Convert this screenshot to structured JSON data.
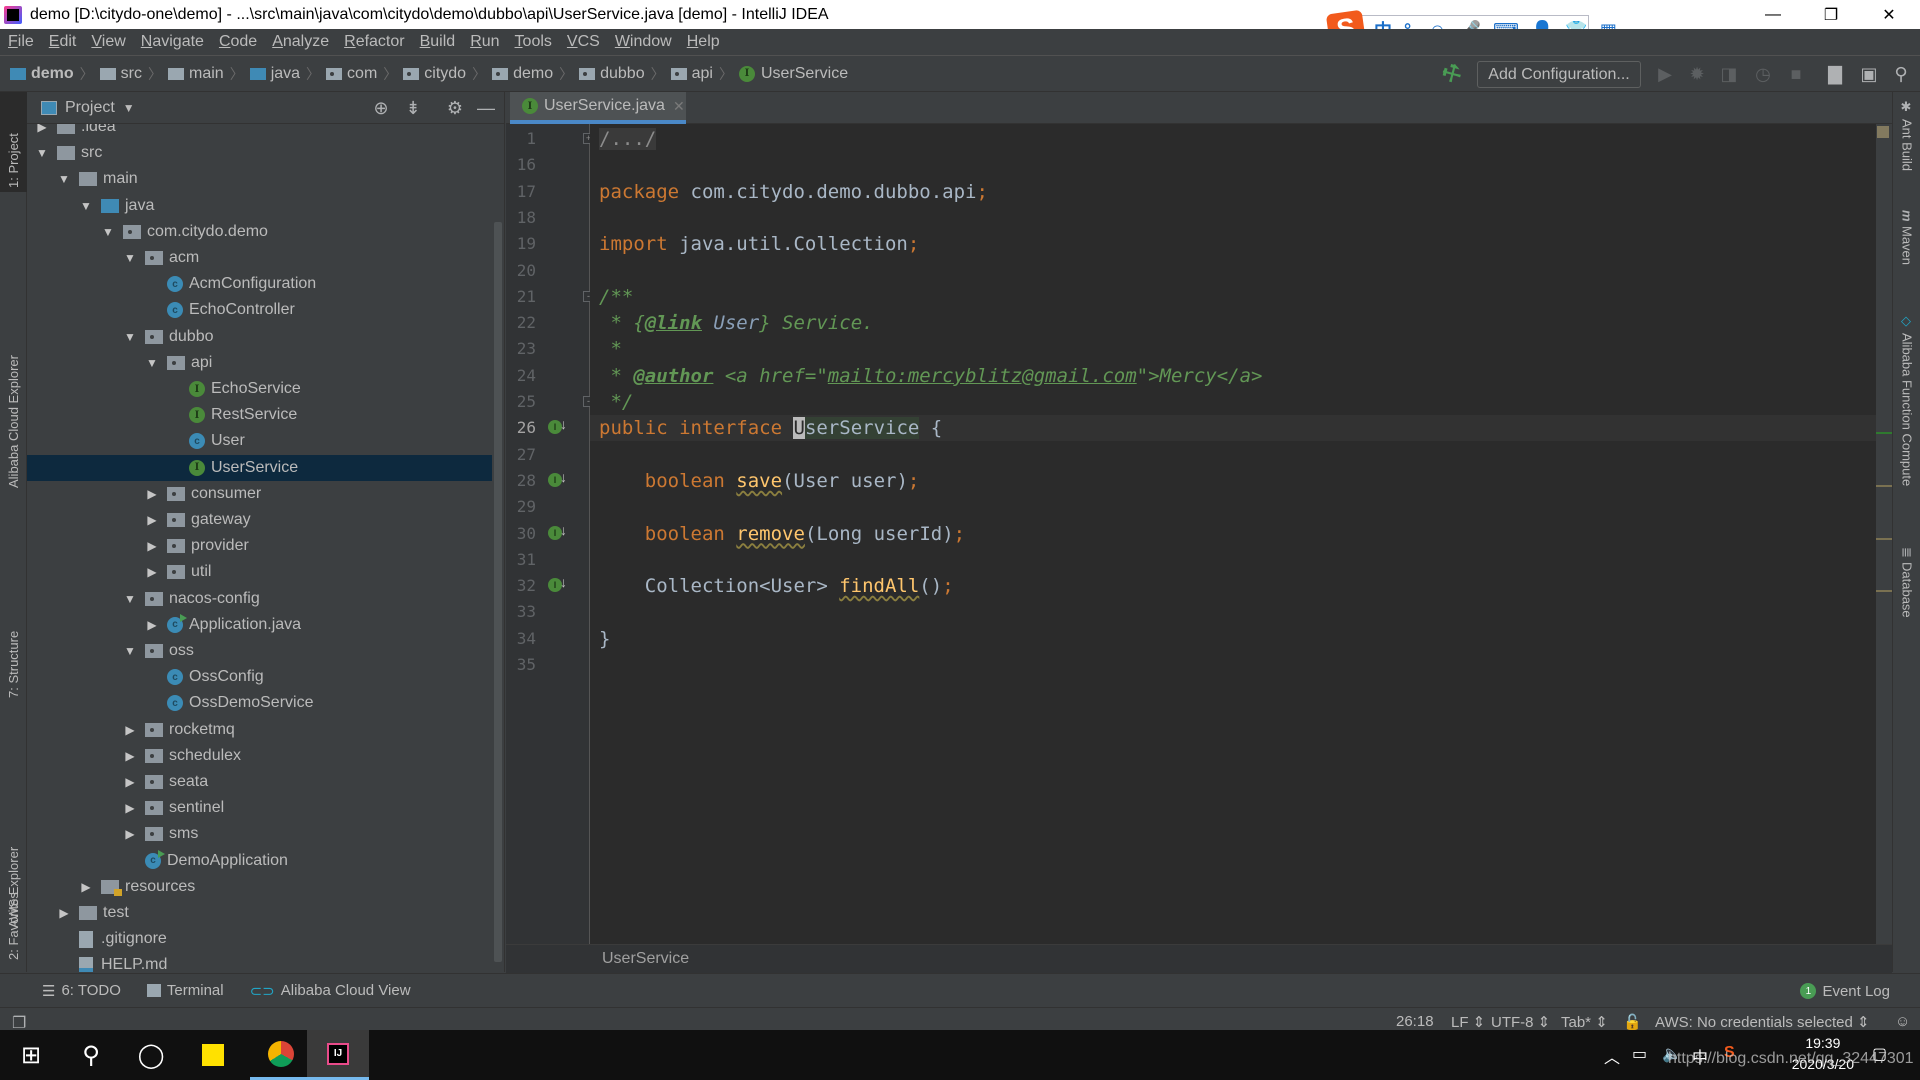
{
  "window": {
    "title": "demo [D:\\citydo-one\\demo] - ...\\src\\main\\java\\com\\citydo\\demo\\dubbo\\api\\UserService.java [demo] - IntelliJ IDEA",
    "minimize": "—",
    "maximize": "❐",
    "close": "✕"
  },
  "ime": {
    "logo": "S",
    "icons": [
      "中",
      "°,",
      "☺",
      "🎤",
      "⌨",
      "👤",
      "👕",
      "▦"
    ]
  },
  "menu": [
    "File",
    "Edit",
    "View",
    "Navigate",
    "Code",
    "Analyze",
    "Refactor",
    "Build",
    "Run",
    "Tools",
    "VCS",
    "Window",
    "Help"
  ],
  "navbar": {
    "crumbs": [
      "demo",
      "src",
      "main",
      "java",
      "com",
      "citydo",
      "demo",
      "dubbo",
      "api",
      "UserService"
    ],
    "add_configuration": "Add Configuration...",
    "icons": [
      "hammer-icon",
      "run-icon",
      "debug-icon",
      "coverage-icon",
      "profile-icon",
      "stop-icon",
      "project-structure-icon",
      "run-anything-icon",
      "search-icon"
    ]
  },
  "left_strip": {
    "tabs": [
      "1: Project",
      "Alibaba Cloud Explorer",
      "7: Structure",
      "AWS Explorer",
      "2: Favorites"
    ]
  },
  "project": {
    "title": "Project",
    "tree": [
      {
        "label": ".idea",
        "kind": "folder",
        "depth": 1,
        "arrow": "collapsed"
      },
      {
        "label": "src",
        "kind": "folder",
        "depth": 1,
        "arrow": "expanded"
      },
      {
        "label": "main",
        "kind": "folder",
        "depth": 2,
        "arrow": "expanded"
      },
      {
        "label": "java",
        "kind": "source-folder",
        "depth": 3,
        "arrow": "expanded"
      },
      {
        "label": "com.citydo.demo",
        "kind": "package",
        "depth": 4,
        "arrow": "expanded"
      },
      {
        "label": "acm",
        "kind": "package",
        "depth": 5,
        "arrow": "expanded"
      },
      {
        "label": "AcmConfiguration",
        "kind": "class",
        "depth": 6,
        "arrow": "none"
      },
      {
        "label": "EchoController",
        "kind": "class",
        "depth": 6,
        "arrow": "none"
      },
      {
        "label": "dubbo",
        "kind": "package",
        "depth": 5,
        "arrow": "expanded"
      },
      {
        "label": "api",
        "kind": "package",
        "depth": 6,
        "arrow": "expanded"
      },
      {
        "label": "EchoService",
        "kind": "interface",
        "depth": 7,
        "arrow": "none"
      },
      {
        "label": "RestService",
        "kind": "interface",
        "depth": 7,
        "arrow": "none"
      },
      {
        "label": "User",
        "kind": "class",
        "depth": 7,
        "arrow": "none"
      },
      {
        "label": "UserService",
        "kind": "interface",
        "depth": 7,
        "arrow": "none",
        "selected": true
      },
      {
        "label": "consumer",
        "kind": "package",
        "depth": 6,
        "arrow": "collapsed"
      },
      {
        "label": "gateway",
        "kind": "package",
        "depth": 6,
        "arrow": "collapsed"
      },
      {
        "label": "provider",
        "kind": "package",
        "depth": 6,
        "arrow": "collapsed"
      },
      {
        "label": "util",
        "kind": "package",
        "depth": 6,
        "arrow": "collapsed"
      },
      {
        "label": "nacos-config",
        "kind": "package",
        "depth": 5,
        "arrow": "expanded"
      },
      {
        "label": "Application.java",
        "kind": "run-class",
        "depth": 6,
        "arrow": "collapsed"
      },
      {
        "label": "oss",
        "kind": "package",
        "depth": 5,
        "arrow": "expanded"
      },
      {
        "label": "OssConfig",
        "kind": "class",
        "depth": 6,
        "arrow": "none"
      },
      {
        "label": "OssDemoService",
        "kind": "class",
        "depth": 6,
        "arrow": "none"
      },
      {
        "label": "rocketmq",
        "kind": "package",
        "depth": 5,
        "arrow": "collapsed"
      },
      {
        "label": "schedulex",
        "kind": "package",
        "depth": 5,
        "arrow": "collapsed"
      },
      {
        "label": "seata",
        "kind": "package",
        "depth": 5,
        "arrow": "collapsed"
      },
      {
        "label": "sentinel",
        "kind": "package",
        "depth": 5,
        "arrow": "collapsed"
      },
      {
        "label": "sms",
        "kind": "package",
        "depth": 5,
        "arrow": "collapsed"
      },
      {
        "label": "DemoApplication",
        "kind": "run-class",
        "depth": 5,
        "arrow": "none"
      },
      {
        "label": "resources",
        "kind": "resources",
        "depth": 3,
        "arrow": "collapsed"
      },
      {
        "label": "test",
        "kind": "folder",
        "depth": 2,
        "arrow": "collapsed"
      },
      {
        "label": ".gitignore",
        "kind": "file",
        "depth": 2,
        "arrow": "none"
      },
      {
        "label": "HELP.md",
        "kind": "md-file",
        "depth": 2,
        "arrow": "none"
      }
    ]
  },
  "editor": {
    "tab": "UserService.java",
    "lines": [
      {
        "no": "1",
        "fold": "+",
        "html": "<span class='fold-text'>/.../</span>"
      },
      {
        "no": "16",
        "html": ""
      },
      {
        "no": "17",
        "html": "<span class='kw'>package</span> com.citydo.demo.dubbo.api<span class='kw'>;</span>"
      },
      {
        "no": "18",
        "html": ""
      },
      {
        "no": "19",
        "html": "<span class='kw'>import</span> java.util.Collection<span class='kw'>;</span>"
      },
      {
        "no": "20",
        "html": ""
      },
      {
        "no": "21",
        "fold": "-",
        "html": "<span class='cm'>/**</span>"
      },
      {
        "no": "22",
        "html": "<span class='cm'> * {<span class='cm-tag'>@link</span> <span class='cm-ref'>User</span>} Service.</span>"
      },
      {
        "no": "23",
        "html": "<span class='cm'> *</span>"
      },
      {
        "no": "24",
        "html": "<span class='cm'> * <span class='cm-tag'>@author</span> &lt;a href=\"<span class='cm-link'>mailto:mercyblitz@gmail.com</span>\"&gt;Mercy&lt;/a&gt;</span>"
      },
      {
        "no": "25",
        "fold": "-",
        "html": "<span class='cm'> */</span>"
      },
      {
        "no": "26",
        "impl": true,
        "current": true,
        "html": "<span class='kw'>public interface</span> <span class='ident-hl'><span class='caret'>U</span>serService</span> {"
      },
      {
        "no": "27",
        "html": ""
      },
      {
        "no": "28",
        "impl": true,
        "html": "    <span class='kw'>boolean</span> <span class='fn'>save</span>(User user)<span class='kw'>;</span>"
      },
      {
        "no": "29",
        "html": ""
      },
      {
        "no": "30",
        "impl": true,
        "html": "    <span class='kw'>boolean</span> <span class='fn'>remove</span>(Long userId)<span class='kw'>;</span>"
      },
      {
        "no": "31",
        "html": ""
      },
      {
        "no": "32",
        "impl": true,
        "html": "    Collection&lt;User&gt; <span class='fn'>findAll</span>()<span class='kw'>;</span>"
      },
      {
        "no": "33",
        "html": ""
      },
      {
        "no": "34",
        "html": "}"
      },
      {
        "no": "35",
        "html": ""
      }
    ],
    "breadcrumb": "UserService"
  },
  "right_strip": {
    "tabs": [
      "Ant Build",
      "Maven",
      "Alibaba Function Compute",
      "Database"
    ]
  },
  "bottom_tools": {
    "todo": "6: TODO",
    "terminal": "Terminal",
    "alibaba_cloud_view": "Alibaba Cloud View",
    "event_log": "Event Log",
    "event_count": "1"
  },
  "statusbar": {
    "position": "26:18",
    "line_sep": "LF ⇕",
    "encoding": "UTF-8 ⇕",
    "indent": "Tab* ⇕",
    "aws": "AWS: No credentials selected ⇕"
  },
  "taskbar": {
    "time": "19:39",
    "date": "2020/3/20",
    "watermark": "https://blog.csdn.net/qq_32447301"
  },
  "colors": {
    "keyword": "#cc7832",
    "comment": "#629755",
    "method": "#ffc66d",
    "text": "#a9b7c6",
    "selection": "#0d293e",
    "accent": "#4a88c7"
  }
}
